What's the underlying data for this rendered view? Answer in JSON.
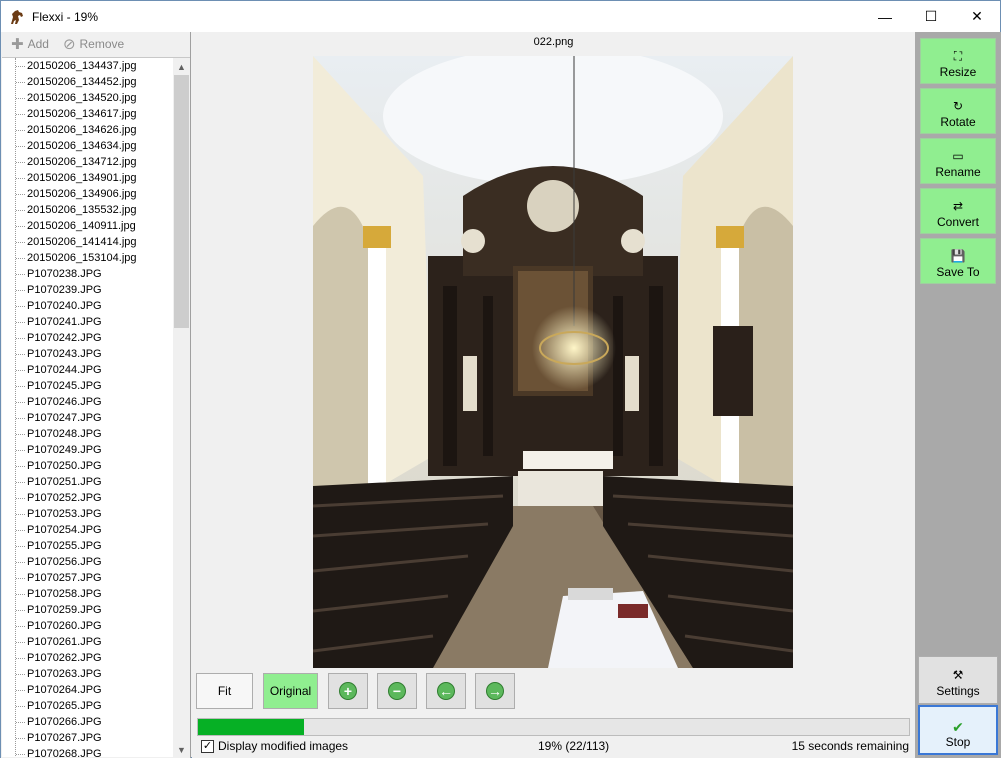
{
  "window": {
    "title": "Flexxi - 19%",
    "minimize": "—",
    "maximize": "☐",
    "close": "✕"
  },
  "toolbar": {
    "add_label": "Add",
    "remove_label": "Remove"
  },
  "files": [
    "20150206_134437.jpg",
    "20150206_134452.jpg",
    "20150206_134520.jpg",
    "20150206_134617.jpg",
    "20150206_134626.jpg",
    "20150206_134634.jpg",
    "20150206_134712.jpg",
    "20150206_134901.jpg",
    "20150206_134906.jpg",
    "20150206_135532.jpg",
    "20150206_140911.jpg",
    "20150206_141414.jpg",
    "20150206_153104.jpg",
    "P1070238.JPG",
    "P1070239.JPG",
    "P1070240.JPG",
    "P1070241.JPG",
    "P1070242.JPG",
    "P1070243.JPG",
    "P1070244.JPG",
    "P1070245.JPG",
    "P1070246.JPG",
    "P1070247.JPG",
    "P1070248.JPG",
    "P1070249.JPG",
    "P1070250.JPG",
    "P1070251.JPG",
    "P1070252.JPG",
    "P1070253.JPG",
    "P1070254.JPG",
    "P1070255.JPG",
    "P1070256.JPG",
    "P1070257.JPG",
    "P1070258.JPG",
    "P1070259.JPG",
    "P1070260.JPG",
    "P1070261.JPG",
    "P1070262.JPG",
    "P1070263.JPG",
    "P1070264.JPG",
    "P1070265.JPG",
    "P1070266.JPG",
    "P1070267.JPG",
    "P1070268.JPG"
  ],
  "preview": {
    "filename": "022.png"
  },
  "controls": {
    "fit_label": "Fit",
    "original_label": "Original"
  },
  "progress": {
    "fraction": 0.149,
    "percent_text": "19% (22/113)",
    "remaining_text": "15 seconds remaining",
    "checkbox_label": "Display modified images",
    "checkbox_checked": true
  },
  "actions": {
    "resize_label": "Resize",
    "rotate_label": "Rotate",
    "rename_label": "Rename",
    "convert_label": "Convert",
    "saveto_label": "Save To",
    "settings_label": "Settings",
    "stop_label": "Stop"
  },
  "colors": {
    "action_green": "#90ee90",
    "progress_green": "#06b025",
    "side_gray": "#a9a9a9"
  }
}
